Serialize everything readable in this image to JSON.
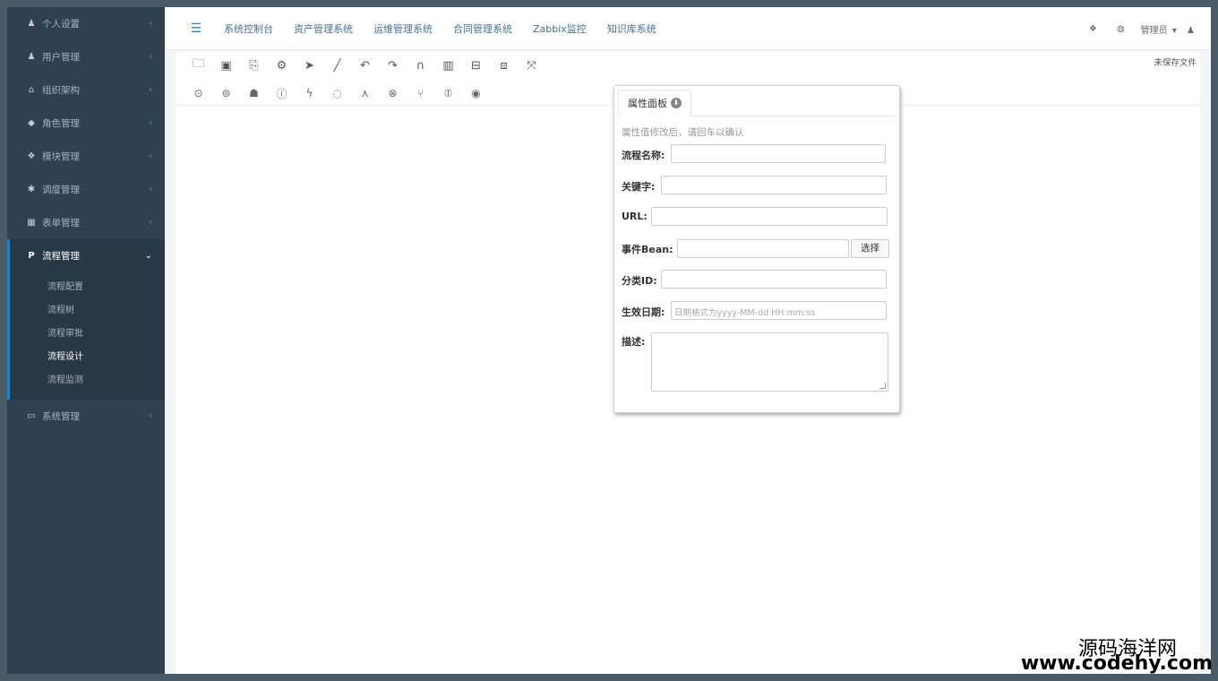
{
  "sidebar": {
    "items": [
      {
        "icon": "user-icon",
        "glyph": "♟",
        "label": "个人设置"
      },
      {
        "icon": "users-icon",
        "glyph": "♟",
        "label": "用户管理"
      },
      {
        "icon": "sitemap-icon",
        "glyph": "⌂",
        "label": "组织架构"
      },
      {
        "icon": "role-icon",
        "glyph": "◆",
        "label": "角色管理"
      },
      {
        "icon": "module-icon",
        "glyph": "❖",
        "label": "模块管理"
      },
      {
        "icon": "schedule-icon",
        "glyph": "✱",
        "label": "调度管理"
      },
      {
        "icon": "grid-icon",
        "glyph": "▦",
        "label": "表单管理"
      },
      {
        "icon": "flow-icon",
        "glyph": "P",
        "label": "流程管理"
      },
      {
        "icon": "laptop-icon",
        "glyph": "▭",
        "label": "系统管理"
      }
    ],
    "sub_items": [
      "流程配置",
      "流程树",
      "流程审批",
      "流程设计",
      "流程监测"
    ]
  },
  "topbar": {
    "menu_toggle_glyph": "☰",
    "nav": [
      "系统控制台",
      "资产管理系统",
      "运维管理系统",
      "合同管理系统",
      "Zabbix监控",
      "知识库系统"
    ],
    "admin_label": "管理员",
    "caret": "▾"
  },
  "toolbar": {
    "unsaved_label": "未保存文件",
    "row1": [
      "open-icon",
      "save-icon",
      "save-as-icon",
      "settings-icon",
      "pointer-icon",
      "line-icon",
      "undo-icon",
      "redo-icon",
      "magnet-icon",
      "delete-icon",
      "align-vertical-icon",
      "align-horizontal-icon",
      "compress-icon"
    ],
    "row2": [
      "start-icon",
      "task-icon",
      "user-task-icon",
      "timer-icon",
      "event-icon",
      "idea-icon",
      "fork-icon",
      "gateway-icon",
      "join-icon",
      "pause-icon",
      "end-icon"
    ]
  },
  "prop_panel": {
    "tab_label": "属性面板",
    "hint": "属性值修改后，请回车以确认",
    "fields": {
      "name_label": "流程名称:",
      "keyword_label": "关键字:",
      "url_label": "URL:",
      "bean_label": "事件Bean:",
      "category_label": "分类ID:",
      "date_label": "生效日期:",
      "date_placeholder": "日期格式为yyyy-MM-dd HH:mm:ss",
      "desc_label": "描述:"
    },
    "select_button": "选择"
  },
  "watermark": {
    "line1": "源码海洋网",
    "line2": "www.codehy.com"
  }
}
